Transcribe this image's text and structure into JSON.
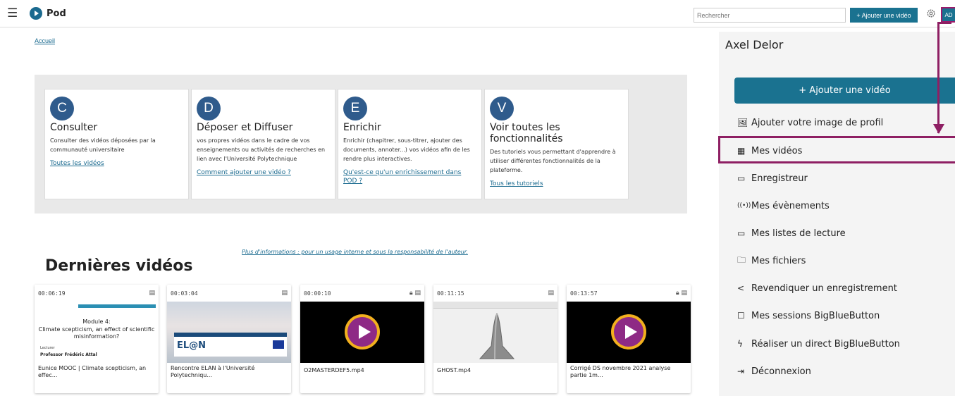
{
  "nav": {
    "brand": "Pod",
    "search_placeholder": "Rechercher",
    "add_video": "+ Ajouter une vidéo",
    "avatar": "AD"
  },
  "breadcrumb": "Accueil",
  "features": [
    {
      "letter": "C",
      "title": "Consulter",
      "desc": "Consulter des vidéos déposées par la communauté universitaire",
      "link": "Toutes les vidéos"
    },
    {
      "letter": "D",
      "title": "Déposer et Diffuser",
      "desc": "vos propres vidéos dans le cadre de vos enseignements ou activités de recherches en lien avec l'Université Polytechnique",
      "link": "Comment ajouter une vidéo ?"
    },
    {
      "letter": "E",
      "title": "Enrichir",
      "desc": "Enrichir (chapitrer, sous-titrer, ajouter des documents, annoter...) vos vidéos afin de les rendre plus interactives.",
      "link": "Qu'est-ce qu'un enrichissement dans POD ?"
    },
    {
      "letter": "V",
      "title": "Voir toutes les fonctionnalités",
      "desc": "Des tutoriels vous permettant d'apprendre à utiliser différentes fonctionnalités de la plateforme.",
      "link": "Tous les tutoriels"
    }
  ],
  "more_info": "Plus d'informations : pour un usage interne et sous la responsabilité de l'auteur.",
  "latest_title": "Dernières vidéos",
  "videos": [
    {
      "duration": "00:06:19",
      "title": "Eunice MOOC | Climate scepticism, an effec...",
      "locked": false,
      "thumb": {
        "module": "Module 4:",
        "subtitle": "Climate scepticism, an effect of scientific misinformation?",
        "lecturer": "Lecturer",
        "professor": "Professor  Frédéric Attal"
      }
    },
    {
      "duration": "00:03:04",
      "title": "Rencontre ELAN à l'Université Polytechniqu...",
      "locked": false,
      "thumb": {
        "logo": "EL@N"
      }
    },
    {
      "duration": "00:00:10",
      "title": "O2MASTERDEF5.mp4",
      "locked": true
    },
    {
      "duration": "00:11:15",
      "title": "GHOST.mp4",
      "locked": false
    },
    {
      "duration": "00:13:57",
      "title": "Corrigé DS novembre 2021 analyse partie 1m...",
      "locked": true
    }
  ],
  "side": {
    "user": "Axel Delor",
    "add_video": "+ Ajouter une vidéo",
    "menu": [
      {
        "icon": "image-icon",
        "label": "Ajouter votre image de profil"
      },
      {
        "icon": "film-icon",
        "label": "Mes vidéos"
      },
      {
        "icon": "recorder-icon",
        "label": "Enregistreur"
      },
      {
        "icon": "broadcast-icon",
        "label": "Mes évènements"
      },
      {
        "icon": "playlist-icon",
        "label": "Mes listes de lecture"
      },
      {
        "icon": "folder-icon",
        "label": "Mes fichiers"
      },
      {
        "icon": "share-icon",
        "label": "Revendiquer un enregistrement"
      },
      {
        "icon": "square-icon",
        "label": "Mes sessions BigBlueButton"
      },
      {
        "icon": "lightning-icon",
        "label": "Réaliser un direct BigBlueButton"
      },
      {
        "icon": "logout-icon",
        "label": "Déconnexion"
      }
    ]
  },
  "colors": {
    "accent": "#1a7290",
    "highlight": "#8e1f63",
    "circle": "#2f5b8c"
  }
}
